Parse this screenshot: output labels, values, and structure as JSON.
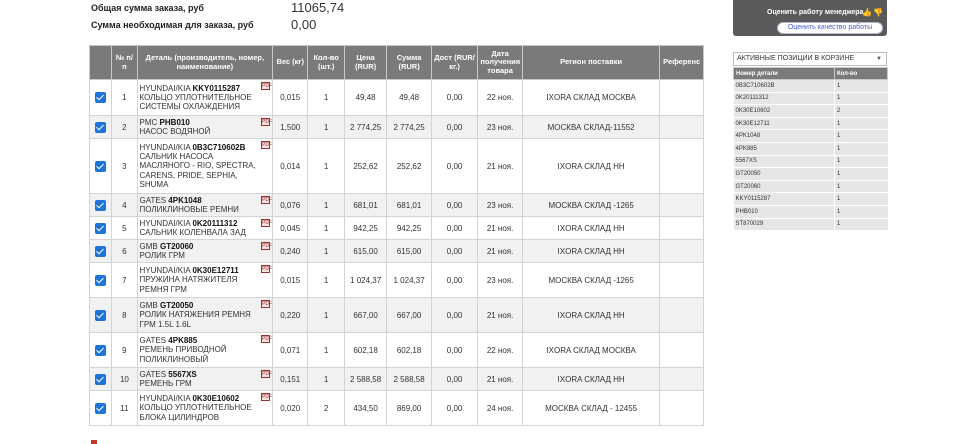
{
  "summary": {
    "total_label": "Общая сумма заказа, руб",
    "total_value": "11065,74",
    "required_label": "Сумма необходимая для заказа, руб",
    "required_value": "0,00"
  },
  "table": {
    "headers": [
      "",
      "№ п/п",
      "Деталь (производитель, номер, наименование)",
      "Вес (кг)",
      "Кол-во (шт.)",
      "Цена (RUR)",
      "Сумма (RUR)",
      "Дост (RUR/кг.)",
      "Дата получения товара",
      "Регион поставки",
      "Референс"
    ],
    "rows": [
      {
        "n": "1",
        "maker": "HYUNDAI/KIA",
        "part": "KKY0115287",
        "name": "КОЛЬЦО УПЛОТНИТЕЛЬНОЕ СИСТЕМЫ ОХЛАЖДЕНИЯ",
        "weight": "0,015",
        "qty": "1",
        "price": "49,48",
        "sum": "49,48",
        "delivery": "0,00",
        "date": "22 ноя.",
        "region": "IXORA СКЛАД МОСКВА",
        "ref": ""
      },
      {
        "n": "2",
        "maker": "PMC",
        "part": "PHB010",
        "name": "НАСОС ВОДЯНОЙ",
        "weight": "1,500",
        "qty": "1",
        "price": "2 774,25",
        "sum": "2 774,25",
        "delivery": "0,00",
        "date": "23 ноя.",
        "region": "МОСКВА СКЛАД-11552",
        "ref": ""
      },
      {
        "n": "3",
        "maker": "HYUNDAI/KIA",
        "part": "0B3C710602B",
        "name": "САЛЬНИК НАСОСА МАСЛЯНОГО - RIO, SPECTRA, CARENS, PRIDE, SEPHIA, SHUMA",
        "weight": "0,014",
        "qty": "1",
        "price": "252,62",
        "sum": "252,62",
        "delivery": "0,00",
        "date": "21 ноя.",
        "region": "IXORA СКЛАД НН",
        "ref": ""
      },
      {
        "n": "4",
        "maker": "GATES",
        "part": "4PK1048",
        "name": "ПОЛИКЛИНОВЫЕ РЕМНИ",
        "weight": "0,076",
        "qty": "1",
        "price": "681,01",
        "sum": "681,01",
        "delivery": "0,00",
        "date": "23 ноя.",
        "region": "МОСКВА СКЛАД -1265",
        "ref": ""
      },
      {
        "n": "5",
        "maker": "HYUNDAI/KIA",
        "part": "0K20111312",
        "name": "САЛЬНИК КОЛЕНВАЛА ЗАД",
        "weight": "0,045",
        "qty": "1",
        "price": "942,25",
        "sum": "942,25",
        "delivery": "0,00",
        "date": "21 ноя.",
        "region": "IXORA СКЛАД НН",
        "ref": ""
      },
      {
        "n": "6",
        "maker": "GMB",
        "part": "GT20060",
        "name": "РОЛИК ГРМ",
        "weight": "0,240",
        "qty": "1",
        "price": "615,00",
        "sum": "615,00",
        "delivery": "0,00",
        "date": "21 ноя.",
        "region": "IXORA СКЛАД НН",
        "ref": ""
      },
      {
        "n": "7",
        "maker": "HYUNDAI/KIA",
        "part": "0K30E12711",
        "name": "ПРУЖИНА НАТЯЖИТЕЛЯ РЕМНЯ ГРМ",
        "weight": "0,015",
        "qty": "1",
        "price": "1 024,37",
        "sum": "1 024,37",
        "delivery": "0,00",
        "date": "23 ноя.",
        "region": "МОСКВА СКЛАД -1265",
        "ref": ""
      },
      {
        "n": "8",
        "maker": "GMB",
        "part": "GT20050",
        "name": "РОЛИК НАТЯЖЕНИЯ РЕМНЯ ГРМ 1.5L 1.6L",
        "weight": "0,220",
        "qty": "1",
        "price": "667,00",
        "sum": "667,00",
        "delivery": "0,00",
        "date": "21 ноя.",
        "region": "IXORA СКЛАД НН",
        "ref": ""
      },
      {
        "n": "9",
        "maker": "GATES",
        "part": "4PK885",
        "name": "РЕМЕНЬ ПРИВОДНОЙ ПОЛИКЛИНОВЫЙ",
        "weight": "0,071",
        "qty": "1",
        "price": "602,18",
        "sum": "602,18",
        "delivery": "0,00",
        "date": "22 ноя.",
        "region": "IXORA СКЛАД МОСКВА",
        "ref": ""
      },
      {
        "n": "10",
        "maker": "GATES",
        "part": "5567XS",
        "name": "РЕМЕНЬ ГРМ",
        "weight": "0,151",
        "qty": "1",
        "price": "2 588,58",
        "sum": "2 588,58",
        "delivery": "0,00",
        "date": "21 ноя.",
        "region": "IXORA СКЛАД НН",
        "ref": ""
      },
      {
        "n": "11",
        "maker": "HYUNDAI/KIA",
        "part": "0K30E10602",
        "name": "КОЛЬЦО УПЛОТНИТЕЛЬНОЕ БЛОКА ЦИЛИНДРОВ",
        "weight": "0,020",
        "qty": "2",
        "price": "434,50",
        "sum": "869,00",
        "delivery": "0,00",
        "date": "24 ноя.",
        "region": "МОСКВА СКЛАД - 12455",
        "ref": ""
      }
    ]
  },
  "manager": {
    "rate_manager_label": "Оценить работу менеджера",
    "rate_quality_label": "Оценить качество работы"
  },
  "cart": {
    "select_label": "АКТИВНЫЕ ПОЗИЦИИ В КОРЗИНЕ",
    "col_part": "Номер детали",
    "col_qty": "Кол-во",
    "items": [
      {
        "part": "0B3C710602B",
        "qty": "1"
      },
      {
        "part": "0K20111312",
        "qty": "1"
      },
      {
        "part": "0K30E10602",
        "qty": "2"
      },
      {
        "part": "0K30E12711",
        "qty": "1"
      },
      {
        "part": "4PK1048",
        "qty": "1"
      },
      {
        "part": "4PK885",
        "qty": "1"
      },
      {
        "part": "5567XS",
        "qty": "1"
      },
      {
        "part": "GT20050",
        "qty": "1"
      },
      {
        "part": "GT20060",
        "qty": "1"
      },
      {
        "part": "KKY0115287",
        "qty": "1"
      },
      {
        "part": "PHB010",
        "qty": "1"
      },
      {
        "part": "ST870029",
        "qty": "1"
      }
    ]
  },
  "colors": {
    "header_bg": "#7a7a7a",
    "checkbox": "#1e74d8",
    "row_alt": "#f1f1f1",
    "link": "#4a5cc8"
  }
}
